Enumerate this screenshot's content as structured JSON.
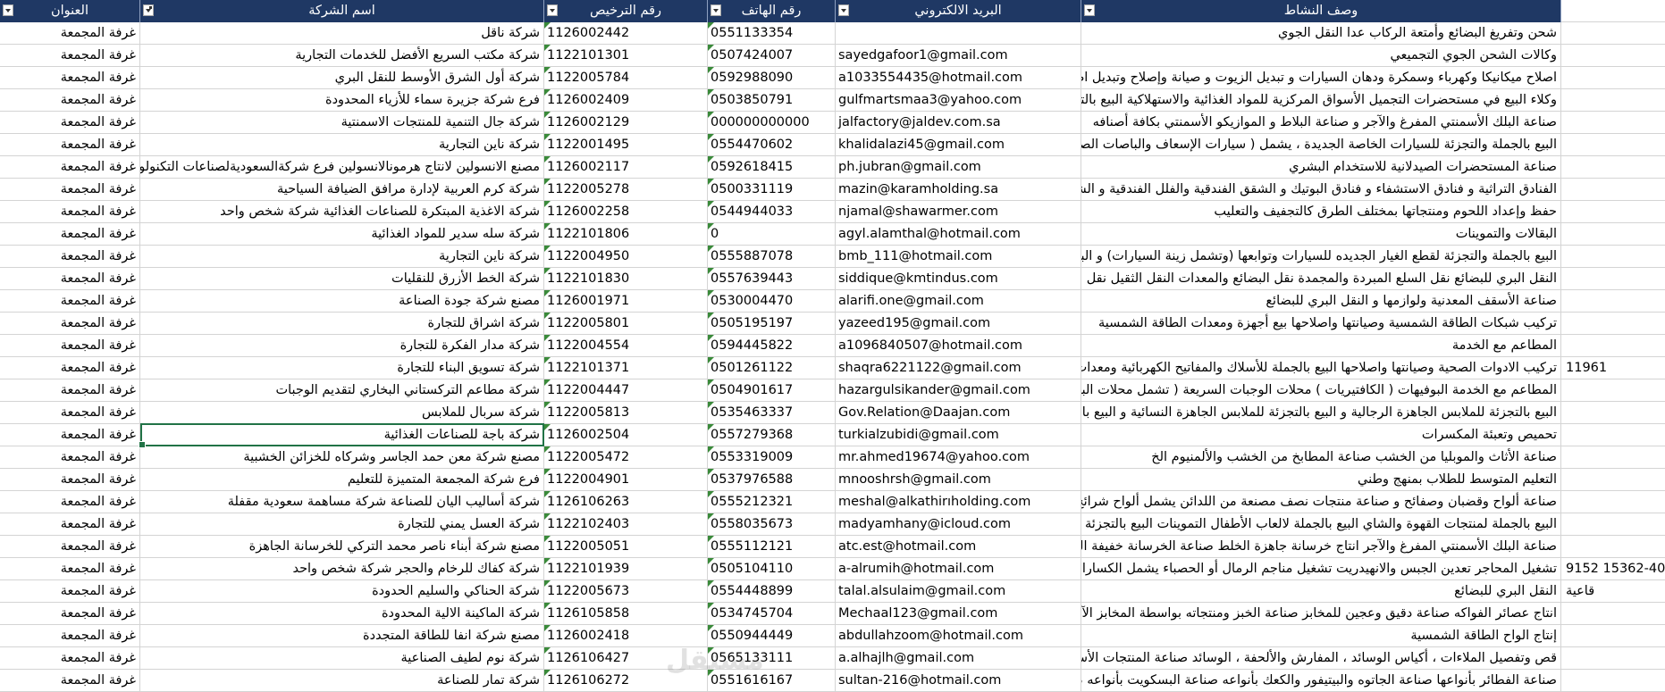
{
  "headers": {
    "address": "العنوان",
    "company": "اسم الشركة",
    "license": "رقم الترخيص",
    "phone": "رقم الهاتف",
    "email": "البريد الالكتروني",
    "activity": "وصف النشاط"
  },
  "rows": [
    {
      "address": "غرفة المجمعة",
      "company": "شركة ناقل",
      "license": "1126002442",
      "phone": "0551133354",
      "email": "",
      "activity": "شحن وتفريغ البضائع وأمتعة الركاب عدا النقل الجوي"
    },
    {
      "address": "غرفة المجمعة",
      "company": "شركة مكتب السريع الأفضل للخدمات التجارية",
      "license": "1122101301",
      "phone": "0507424007",
      "email": "sayedgafoor1@gmail.com",
      "activity": "وكالات الشحن الجوي التجميعي"
    },
    {
      "address": "غرفة المجمعة",
      "company": "شركة أول الشرق الأوسط للنقل البري",
      "license": "1122005784",
      "phone": "0592988090",
      "email": "a1033554435@hotmail.com",
      "activity": "اصلاح ميكانيكا وكهرباء وسمكرة ودهان السيارات و تبديل الزيوت و صيانة وإصلاح وتبديل اطارات السيارات"
    },
    {
      "address": "غرفة المجمعة",
      "company": "فرع شركة جزيرة سماء للأزياء المحدودة",
      "license": "1126002409",
      "phone": "0503850791",
      "email": "gulfmartsmaa3@yahoo.com",
      "activity": "وكلاء البيع في مستحضرات التجميل الأسواق المركزية للمواد الغذائية والاستهلاكية البيع بالتجزئة للأقمشة"
    },
    {
      "address": "غرفة المجمعة",
      "company": "شركة جال التنمية للمنتجات الاسمنتية",
      "license": "1126002129",
      "phone": "000000000000",
      "email": "jalfactory@jaldev.com.sa",
      "activity": "صناعة البلك الأسمنتي المفرغ والآجر و صناعة البلاط و الموازيكو الأسمنتي بكافة أصنافه"
    },
    {
      "address": "غرفة المجمعة",
      "company": "شركة ناين التجارية",
      "license": "1122001495",
      "phone": "0554470602",
      "email": "khalidalazi45@gmail.com",
      "activity": "البيع بالجملة والتجزئة للسيارات الخاصة الجديدة ، يشمل ( سيارات الإسعاف والباصات الصغيرة وسيارات النقل )"
    },
    {
      "address": "غرفة المجمعة",
      "company": "مصنع الانسولين لانتاج هرمونالانسولين فرع شركةالسعوديةلصناعات التكنولوجيا",
      "license": "1126002117",
      "phone": "0592618415",
      "email": "ph.jubran@gmail.com",
      "activity": "صناعة المستحضرات الصيدلانية للاستخدام البشري"
    },
    {
      "address": "غرفة المجمعة",
      "company": "شركة كرم العربية لإدارة مرافق الضيافة السياحية",
      "license": "1122005278",
      "phone": "0500331119",
      "email": "mazin@karamholding.sa",
      "activity": "الفنادق التراثية و فنادق الاستشفاء و فنادق البوتيك و الشقق الفندقية والفلل الفندقية و الشقق المفروشة"
    },
    {
      "address": "غرفة المجمعة",
      "company": "شركة الاغذية المبتكرة للصناعات الغذائية شركة شخص واحد",
      "license": "1126002258",
      "phone": "0544944033",
      "email": "njamal@shawarmer.com",
      "activity": "حفظ وإعداد اللحوم ومنتجاتها بمختلف الطرق كالتجفيف والتعليب"
    },
    {
      "address": "غرفة المجمعة",
      "company": "شركة سله سدير للمواد الغذائية",
      "license": "1122101806",
      "phone": "0",
      "email": "agyl.alamthal@hotmail.com",
      "activity": "البقالات والتموينات"
    },
    {
      "address": "غرفة المجمعة",
      "company": "شركة ناين التجارية",
      "license": "1122004950",
      "phone": "0555887078",
      "email": "bmb_111@hotmail.com",
      "activity": "البيع بالجملة والتجزئة لقطع الغيار الجديده للسيارات وتوابعها (وتشمل زينة السيارات) و البيع بالجملة"
    },
    {
      "address": "غرفة المجمعة",
      "company": "شركة الخط الأزرق للنقليات",
      "license": "1122101830",
      "phone": "0557639443",
      "email": "siddique@kmtindus.com",
      "activity": "النقل البري للبضائع نقل السلع المبردة والمجمدة نقل البضائع والمعدات النقل الثقيل نقل السوائل"
    },
    {
      "address": "غرفة المجمعة",
      "company": "مصنع شركة جودة الصناعة",
      "license": "1126001971",
      "phone": "0530004470",
      "email": "alarifi.one@gmail.com",
      "activity": "صناعة الأسقف المعدنية ولوازمها و النقل البري للبضائع"
    },
    {
      "address": "غرفة المجمعة",
      "company": "شركة اشراق للتجارة",
      "license": "1122005801",
      "phone": "0505195197",
      "email": "yazeed195@gmail.com",
      "activity": "تركيب شبكات الطاقة الشمسية وصيانتها واصلاحها بيع أجهزة ومعدات الطاقة الشمسية"
    },
    {
      "address": "غرفة المجمعة",
      "company": "شركة مدار الفكرة للتجارة",
      "license": "1122004554",
      "phone": "0594445822",
      "email": "a1096840507@hotmail.com",
      "activity": "المطاعم مع الخدمة"
    },
    {
      "address": "غرفة المجمعة",
      "company": "شركة تسويق البناء للتجارة",
      "license": "1122101371",
      "phone": "0501261122",
      "email": "shaqra6221122@gmail.com",
      "activity": "تركيب الادوات الصحية وصيانتها واصلاحها البيع بالجملة للأسلاك والمفاتيح الكهربائية ومعدات الانارة"
    },
    {
      "address": "غرفة المجمعة",
      "company": "شركة مطاعم التركستاني البخاري لتقديم الوجبات",
      "license": "1122004447",
      "phone": "0504901617",
      "email": "hazargulsikander@gmail.com",
      "activity": "المطاعم مع الخدمة البوفيهات ( الكافتيريات ) محلات الوجبات السريعة ( تشمل محلات البيتزا )"
    },
    {
      "address": "غرفة المجمعة",
      "company": "شركة سربال للملابس",
      "license": "1122005813",
      "phone": "0535463337",
      "email": "Gov.Relation@Daajan.com",
      "activity": "البيع بالتجزئة للملابس الجاهزة الرجالية و البيع بالتجزئة للملابس الجاهزة النسائية و البيع بالتجزئة"
    },
    {
      "address": "غرفة المجمعة",
      "company": "شركة باجة للصناعات الغذائية",
      "license": "1126002504",
      "phone": "0557279368",
      "email": "turkialzubidi@gmail.com",
      "activity": "تحميص وتعبئة المكسرات"
    },
    {
      "address": "غرفة المجمعة",
      "company": "مصنع شركة معن حمد الجاسر وشركاه للخزائن الخشبية",
      "license": "1122005472",
      "phone": "0553319009",
      "email": "mr.ahmed19674@yahoo.com",
      "activity": "صناعة الأثاث والموبليا من الخشب صناعة المطابخ من الخشب والألمنيوم  الخ"
    },
    {
      "address": "غرفة المجمعة",
      "company": "فرع شركة المجمعة المتميزة للتعليم",
      "license": "1122004901",
      "phone": "0537976588",
      "email": "mnooshrsh@gmail.com",
      "activity": "التعليم المتوسط للطلاب بمنهج وطني"
    },
    {
      "address": "غرفة المجمعة",
      "company": "شركة أساليب اليان للصناعة شركة مساهمة سعودية مقفلة",
      "license": "1126106263",
      "phone": "0555212321",
      "email": "meshal@alkathirıholding.com",
      "activity": "صناعة ألواح وقضبان وصفائح و صناعة منتجات نصف مصنعة من اللدائن  يشمل  ألواح  شرائح  صفائح"
    },
    {
      "address": "غرفة المجمعة",
      "company": "شركة العسل يمني للتجارة",
      "license": "1122102403",
      "phone": "0558035673",
      "email": "madyamhany@icloud.com",
      "activity": "البيع بالجملة لمنتجات القهوة والشاي البيع بالجملة  لالعاب الأطفال التموينات البيع بالتجزئة للتمور"
    },
    {
      "address": "غرفة المجمعة",
      "company": "مصنع شركة أبناء ناصر محمد التركي للخرسانة الجاهزة",
      "license": "1122005051",
      "phone": "0555112121",
      "email": "atc.est@hotmail.com",
      "activity": "صناعة البلك الأسمنتي المفرغ والآجر انتاج خرسانة جاهزة الخلط صناعة الخرسانة خفيفة الوزن الإسمنتية"
    },
    {
      "address": "غرفة المجمعة",
      "company": "شركة كفاك للرخام والحجر شركة شخص واحد",
      "license": "1122101939",
      "phone": "0505104110",
      "email": "a-alrumih@hotmail.com",
      "activity": "تشغيل المحاجر تعدين الجبس والانهيدريت تشغيل مناجم الرمال أو الحصباء  يشمل  الكسارات"
    },
    {
      "address": "غرفة المجمعة",
      "company": "شركة الحناكي والسليم الحدودة",
      "license": "1122005673",
      "phone": "0554448899",
      "email": "talal.alsulaim@gmail.com",
      "activity": "النقل البري للبضائع"
    },
    {
      "address": "غرفة المجمعة",
      "company": "شركة الماكينة الالية المحدودة",
      "license": "1126105858",
      "phone": "0534745704",
      "email": "Mechaal123@gmail.com",
      "activity": "انتاج عصائر الفواكه صناعة دقيق وعجين للمخابز صناعة الخبز ومنتجاته بواسطة المخابز الآلية ص"
    },
    {
      "address": "غرفة المجمعة",
      "company": "مصنع شركة انفا للطاقة المتجددة",
      "license": "1126002418",
      "phone": "0550944449",
      "email": "abdullahzoom@hotmail.com",
      "activity": "إنتاج الواح الطاقة الشمسية"
    },
    {
      "address": "غرفة المجمعة",
      "company": "شركة نوم لطيف الصناعية",
      "license": "1126106427",
      "phone": "0565133111",
      "email": "a.alhajlh@gmail.com",
      "activity": "قص وتفصيل الملاءات ، أكياس الوسائد ، المفارش والألحفة ، الوسائد  صناعة المنتجات الأسفنجية"
    },
    {
      "address": "غرفة المجمعة",
      "company": "شركة تمار للصناعة",
      "license": "1126106272",
      "phone": "0551616167",
      "email": "sultan-216@hotmail.com",
      "activity": "صناعة الفطائر بأنواعها صناعة الجاتوه والبيتيفور والكعك بأنواعه صناعة البسكويت بأنواعه صناعة"
    }
  ],
  "outside": [
    {
      "row": 15,
      "text": "11961"
    },
    {
      "row": 24,
      "text": "9152 15362-40"
    },
    {
      "row": 25,
      "text": "قاعية"
    }
  ],
  "selected_row": 18,
  "watermark": "مستقل"
}
